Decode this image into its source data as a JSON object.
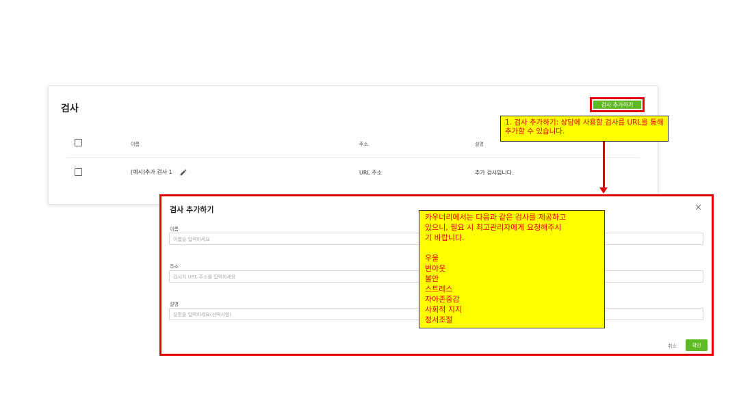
{
  "card": {
    "title": "검사",
    "add_button": "검사 추가하기",
    "columns": {
      "name": "이름",
      "address": "주소",
      "description": "설명"
    },
    "rows": [
      {
        "name": "[예시]추가 검사 1",
        "address": "URL 주소",
        "description": "추가 검사입니다."
      }
    ]
  },
  "annotation1": {
    "text": "1. 검사 추가하기: 상담에 사용할 검사를 URL을 통해 추가할 수 있습니다."
  },
  "modal": {
    "title": "검사 추가하기",
    "close": "×",
    "fields": [
      {
        "label": "이름",
        "placeholder": "이름을 입력하세요"
      },
      {
        "label": "주소",
        "placeholder": "검사지 URL 주소를 입력하세요"
      },
      {
        "label": "설명",
        "placeholder": "설명을 입력하세요(선택사항)"
      }
    ],
    "cancel": "취소",
    "confirm": "확인"
  },
  "annotation2": {
    "lines": [
      "카우너리에서는 다음과 같은 검사를 제공하고",
      "있으니, 필요 시 최고관리자에게 요청해주시",
      "기 바랍니다.",
      "",
      "우울",
      "번아웃",
      "불안",
      "스트레스",
      "자아존중감",
      "사회적 지지",
      "정서조절"
    ]
  },
  "colors": {
    "accent_green": "#5fb923",
    "annotation_red": "#e00000",
    "annotation_yellow": "#ffff00"
  },
  "icons": {
    "edit": "pencil-icon",
    "close": "close-icon"
  }
}
